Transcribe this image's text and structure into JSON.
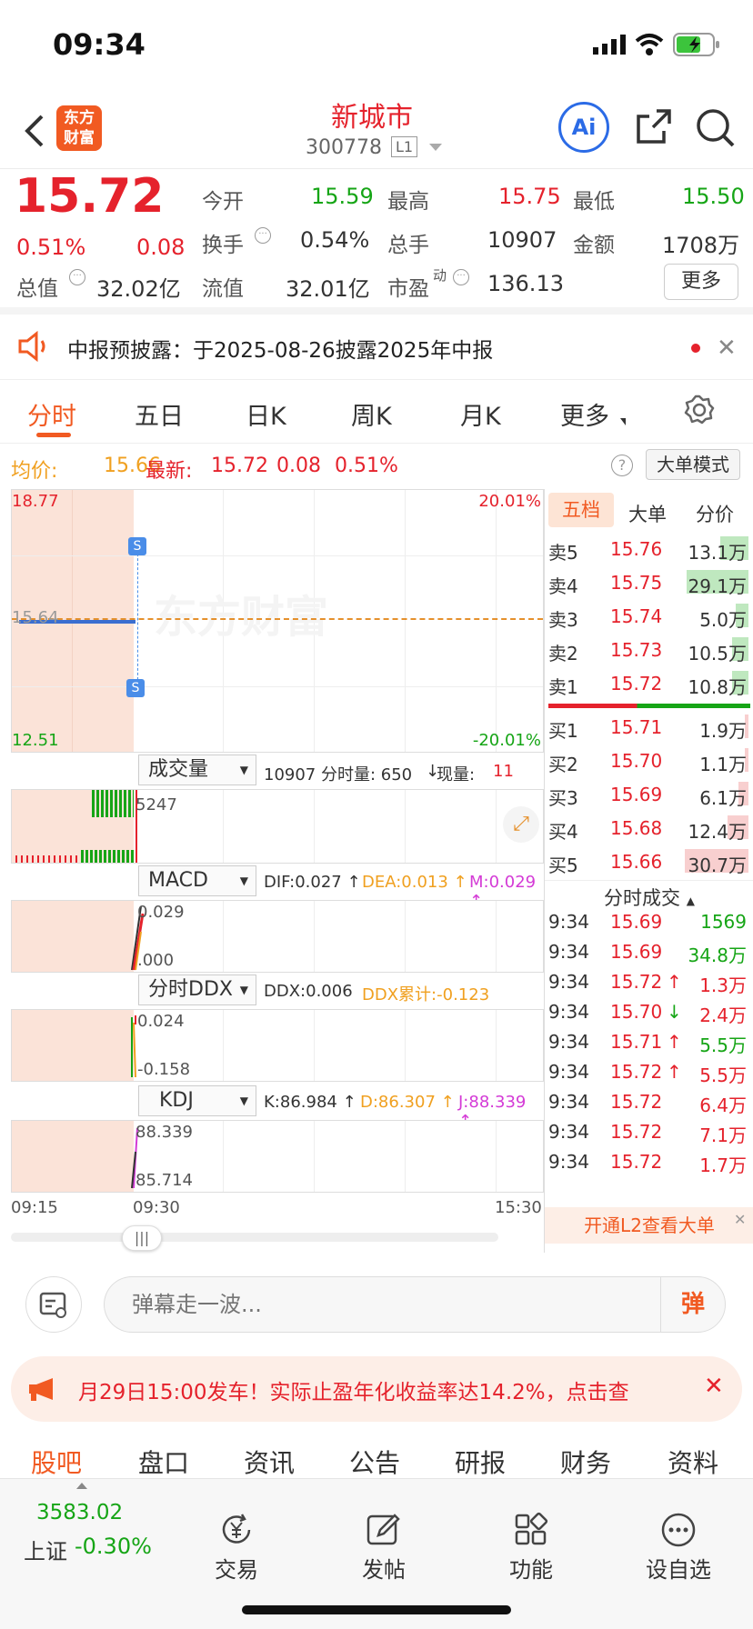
{
  "status": {
    "time": "09:34"
  },
  "header": {
    "title": "新城市",
    "code": "300778",
    "level": "L1",
    "logo_text": "东方财富",
    "ai_label": "Ai"
  },
  "quote": {
    "price": "15.72",
    "pct": "0.51%",
    "chg": "0.08",
    "open_label": "今开",
    "open": "15.59",
    "high_label": "最高",
    "high": "15.75",
    "low_label": "最低",
    "low": "15.50",
    "turnover_label": "换手",
    "turnover": "0.54%",
    "volume_label": "总手",
    "volume": "10907",
    "amount_label": "金额",
    "amount": "1708万",
    "mktcap_label": "总值",
    "mktcap": "32.02亿",
    "float_label": "流值",
    "float": "32.01亿",
    "pe_label": "市盈",
    "pe_sup": "动",
    "pe": "136.13",
    "more": "更多"
  },
  "notice": {
    "text": "中报预披露：于2025-08-26披露2025年中报"
  },
  "tabs": [
    "分时",
    "五日",
    "日K",
    "周K",
    "月K",
    "更多"
  ],
  "infoline": {
    "avg_label": "均价:",
    "avg": "15.66",
    "latest_label": "最新:",
    "latest": "15.72",
    "chg": "0.08",
    "pct": "0.51%",
    "big_mode": "大单模式"
  },
  "main_chart": {
    "top_price": "18.77",
    "bottom_price": "12.51",
    "top_pct": "20.01%",
    "bottom_pct": "-20.01%",
    "mid_price": "15.64",
    "watermark": "东方财富",
    "marker_s": "S"
  },
  "volume": {
    "selector": "成交量",
    "text_prefix": "10907 分时量: 650",
    "arrow": "↓",
    "now_label": " 现量: ",
    "now": "11",
    "max": "5247"
  },
  "macd": {
    "selector": "MACD",
    "dif": "DIF:0.027 ↑",
    "dea": "DEA:0.013 ↑",
    "m": "M:0.029 ↑",
    "top": "0.029",
    "bottom": ".000"
  },
  "ddx": {
    "selector": "分时DDX",
    "ddx": "DDX:0.006",
    "cum": "DDX累计:-0.123",
    "top": "0.024",
    "bottom": "-0.158"
  },
  "kdj": {
    "selector": "KDJ",
    "k": "K:86.984 ↑",
    "d": "D:86.307 ↑",
    "j": "J:88.339 ↑",
    "top": "88.339",
    "bottom": "85.714"
  },
  "time_axis": [
    "09:15",
    "09:30",
    "15:30"
  ],
  "side_tabs": [
    "五档",
    "大单",
    "分价"
  ],
  "asks": [
    {
      "label": "卖5",
      "price": "15.76",
      "vol": "13.1万",
      "fill": 0.35
    },
    {
      "label": "卖4",
      "price": "15.75",
      "vol": "29.1万",
      "fill": 0.75
    },
    {
      "label": "卖3",
      "price": "15.74",
      "vol": "5.0万",
      "fill": 0.15
    },
    {
      "label": "卖2",
      "price": "15.73",
      "vol": "10.5万",
      "fill": 0.2
    },
    {
      "label": "卖1",
      "price": "15.72",
      "vol": "10.8万",
      "fill": 0.2
    }
  ],
  "bids": [
    {
      "label": "买1",
      "price": "15.71",
      "vol": "1.9万",
      "fill": 0.03
    },
    {
      "label": "买2",
      "price": "15.70",
      "vol": "1.1万",
      "fill": 0.02
    },
    {
      "label": "买3",
      "price": "15.69",
      "vol": "6.1万",
      "fill": 0.12
    },
    {
      "label": "买4",
      "price": "15.68",
      "vol": "12.4万",
      "fill": 0.25
    },
    {
      "label": "买5",
      "price": "15.66",
      "vol": "30.7万",
      "fill": 0.78
    }
  ],
  "ticks_title": "分时成交",
  "ticks": [
    {
      "t": "9:34",
      "p": "15.69",
      "v": "1569",
      "dir": "",
      "vcolor": "green"
    },
    {
      "t": "9:34",
      "p": "15.69",
      "v": "34.8万",
      "dir": "",
      "vcolor": "green"
    },
    {
      "t": "9:34",
      "p": "15.72",
      "v": "1.3万",
      "dir": "↑",
      "vcolor": "red"
    },
    {
      "t": "9:34",
      "p": "15.70",
      "v": "2.4万",
      "dir": "↓",
      "vcolor": "red"
    },
    {
      "t": "9:34",
      "p": "15.71",
      "v": "5.5万",
      "dir": "↑",
      "vcolor": "green"
    },
    {
      "t": "9:34",
      "p": "15.72",
      "v": "5.5万",
      "dir": "↑",
      "vcolor": "red"
    },
    {
      "t": "9:34",
      "p": "15.72",
      "v": "6.4万",
      "dir": "",
      "vcolor": "red"
    },
    {
      "t": "9:34",
      "p": "15.72",
      "v": "7.1万",
      "dir": "",
      "vcolor": "red"
    },
    {
      "t": "9:34",
      "p": "15.72",
      "v": "1.7万",
      "dir": "",
      "vcolor": "red"
    }
  ],
  "l2_banner": "开通L2查看大单",
  "danmu": {
    "placeholder": "弹幕走一波...",
    "send": "弹"
  },
  "promo": {
    "text": "月29日15:00发车！实际止盈年化收益率达14.2%，点击查"
  },
  "bottom_tabs": [
    "股吧",
    "盘口",
    "资讯",
    "公告",
    "研报",
    "财务",
    "资料"
  ],
  "footer": {
    "index_value": "3583.02",
    "index_name": "上证",
    "index_pct": "-0.30%",
    "items": [
      "交易",
      "发帖",
      "功能",
      "设自选"
    ]
  }
}
